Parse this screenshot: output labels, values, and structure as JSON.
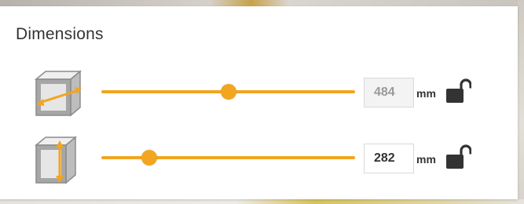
{
  "panel": {
    "title": "Dimensions"
  },
  "rows": [
    {
      "name": "width",
      "icon": "cabinet-width-icon",
      "slider_fraction": 0.5,
      "value": "484",
      "disabled": true,
      "unit": "mm",
      "lock_icon": "unlocked-padlock-icon"
    },
    {
      "name": "height",
      "icon": "cabinet-height-icon",
      "slider_fraction": 0.19,
      "value": "282",
      "disabled": false,
      "unit": "mm",
      "lock_icon": "unlocked-padlock-icon"
    }
  ],
  "colors": {
    "accent": "#f2a51f",
    "text": "#333333",
    "icon_gray": "#8c8c8c",
    "icon_light": "#e6e6e6"
  }
}
